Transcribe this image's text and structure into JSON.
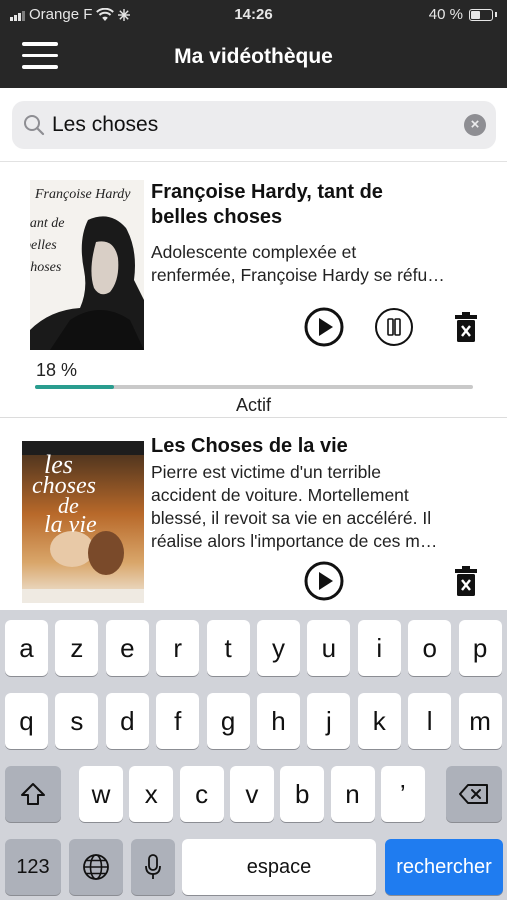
{
  "status_bar": {
    "carrier": "Orange F",
    "time": "14:26",
    "battery": "40 %",
    "battery_level": 0.4
  },
  "header": {
    "title": "Ma vidéothèque"
  },
  "search": {
    "value": "Les choses"
  },
  "results": [
    {
      "title_line1": "Françoise Hardy, tant de",
      "title_line2": "belles choses",
      "desc_line1": "Adolescente complexée et",
      "desc_line2": "renfermée, Françoise Hardy se réfu…",
      "poster_lines": [
        "Françoise Hardy",
        "tant de",
        "belles",
        "choses"
      ],
      "progress_label": "18 %",
      "progress": 0.18,
      "status": "Actif",
      "accent": "#2a9d8f"
    },
    {
      "title": "Les Choses de la vie",
      "desc_lines": [
        "Pierre est victime d'un terrible",
        "accident de voiture. Mortellement",
        "blessé, il revoit sa vie en accéléré. Il",
        "réalise alors l'importance de ces m…"
      ],
      "poster_lines": [
        "les",
        "choses",
        "de",
        "la vie"
      ]
    }
  ],
  "keyboard": {
    "row1": [
      "a",
      "z",
      "e",
      "r",
      "t",
      "y",
      "u",
      "i",
      "o",
      "p"
    ],
    "row2": [
      "q",
      "s",
      "d",
      "f",
      "g",
      "h",
      "j",
      "k",
      "l",
      "m"
    ],
    "row3": [
      "w",
      "x",
      "c",
      "v",
      "b",
      "n",
      "’"
    ],
    "numbers_label": "123",
    "space_label": "espace",
    "search_label": "rechercher"
  }
}
